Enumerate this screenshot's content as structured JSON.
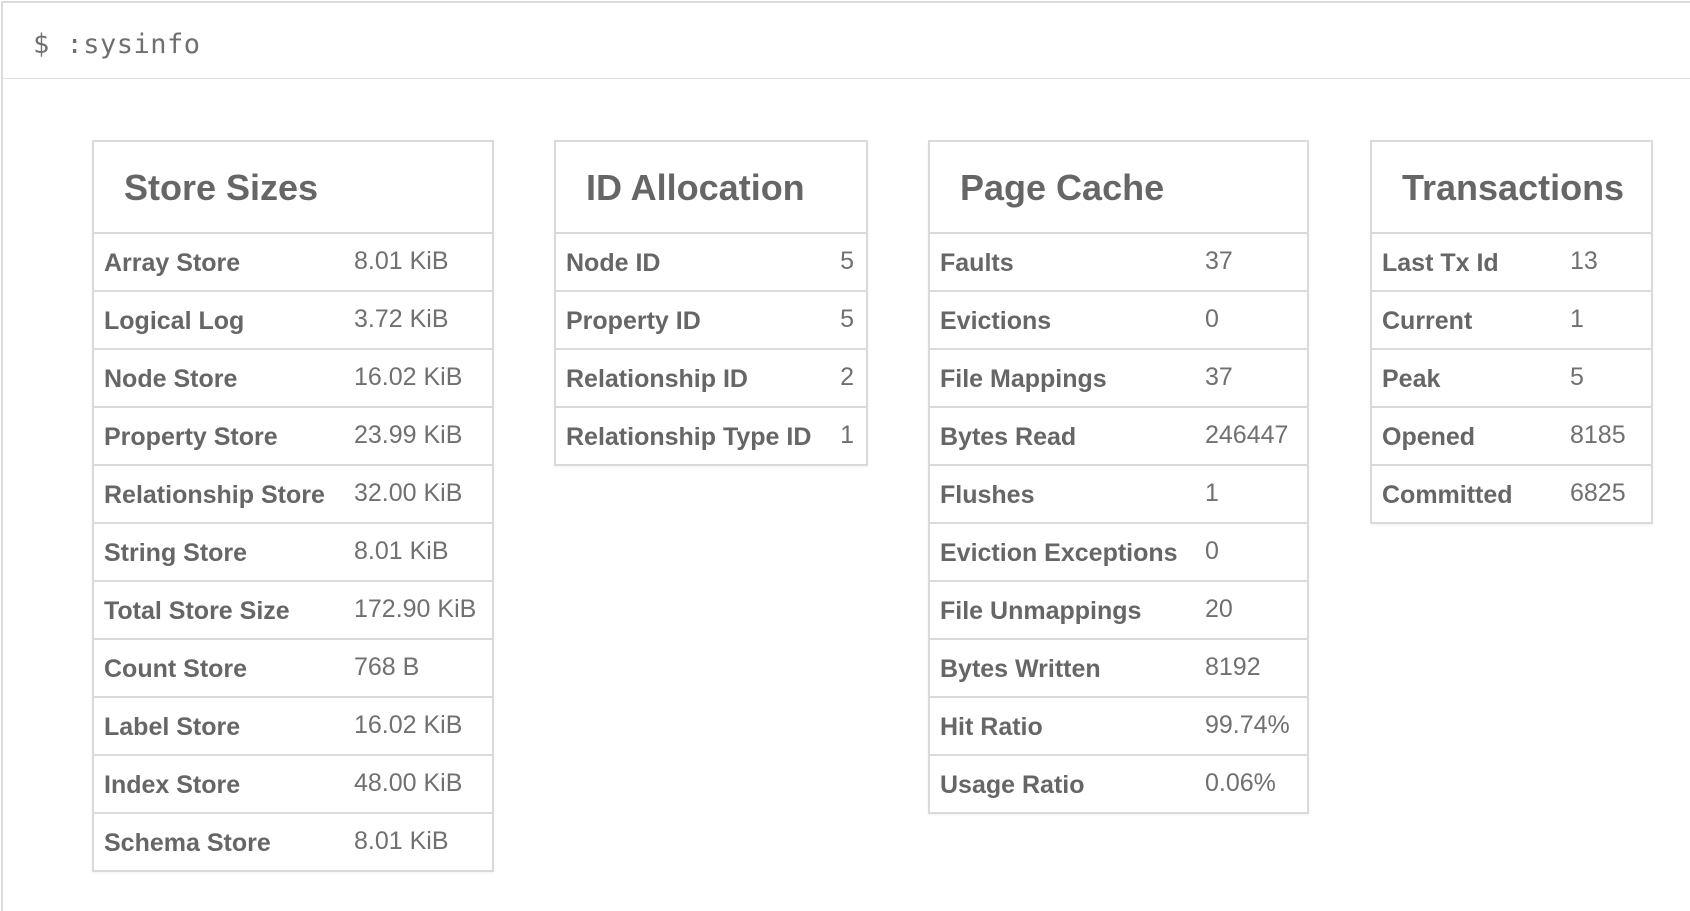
{
  "command": "$ :sysinfo",
  "store_sizes": {
    "title": "Store Sizes",
    "rows": [
      {
        "label": "Array Store",
        "value": "8.01 KiB"
      },
      {
        "label": "Logical Log",
        "value": "3.72 KiB"
      },
      {
        "label": "Node Store",
        "value": "16.02 KiB"
      },
      {
        "label": "Property Store",
        "value": "23.99 KiB"
      },
      {
        "label": "Relationship Store",
        "value": "32.00 KiB"
      },
      {
        "label": "String Store",
        "value": "8.01 KiB"
      },
      {
        "label": "Total Store Size",
        "value": "172.90 KiB"
      },
      {
        "label": "Count Store",
        "value": "768 B"
      },
      {
        "label": "Label Store",
        "value": "16.02 KiB"
      },
      {
        "label": "Index Store",
        "value": "48.00 KiB"
      },
      {
        "label": "Schema Store",
        "value": "8.01 KiB"
      }
    ]
  },
  "id_allocation": {
    "title": "ID Allocation",
    "rows": [
      {
        "label": "Node ID",
        "value": "5"
      },
      {
        "label": "Property ID",
        "value": "5"
      },
      {
        "label": "Relationship ID",
        "value": "2"
      },
      {
        "label": "Relationship Type ID",
        "value": "1"
      }
    ]
  },
  "page_cache": {
    "title": "Page Cache",
    "rows": [
      {
        "label": "Faults",
        "value": "37"
      },
      {
        "label": "Evictions",
        "value": "0"
      },
      {
        "label": "File Mappings",
        "value": "37"
      },
      {
        "label": "Bytes Read",
        "value": "246447"
      },
      {
        "label": "Flushes",
        "value": "1"
      },
      {
        "label": "Eviction Exceptions",
        "value": "0"
      },
      {
        "label": "File Unmappings",
        "value": "20"
      },
      {
        "label": "Bytes Written",
        "value": "8192"
      },
      {
        "label": "Hit Ratio",
        "value": "99.74%"
      },
      {
        "label": "Usage Ratio",
        "value": "0.06%"
      }
    ]
  },
  "transactions": {
    "title": "Transactions",
    "rows": [
      {
        "label": "Last Tx Id",
        "value": "13"
      },
      {
        "label": "Current",
        "value": "1"
      },
      {
        "label": "Peak",
        "value": "5"
      },
      {
        "label": "Opened",
        "value": "8185"
      },
      {
        "label": "Committed",
        "value": "6825"
      }
    ]
  }
}
